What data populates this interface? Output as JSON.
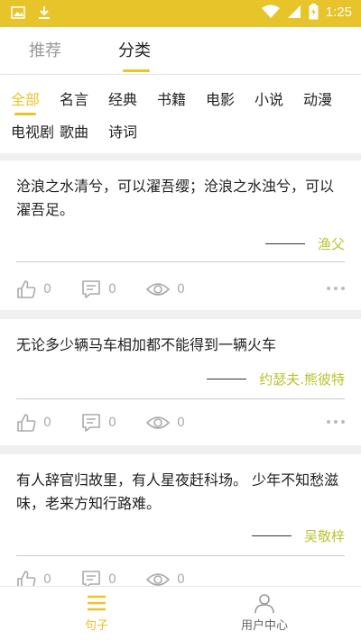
{
  "status": {
    "time": "1:25"
  },
  "top_tabs": [
    {
      "label": "推荐",
      "active": false
    },
    {
      "label": "分类",
      "active": true
    }
  ],
  "categories": [
    {
      "label": "全部",
      "active": true
    },
    {
      "label": "名言"
    },
    {
      "label": "经典"
    },
    {
      "label": "书籍"
    },
    {
      "label": "电影"
    },
    {
      "label": "小说"
    },
    {
      "label": "动漫"
    },
    {
      "label": "电视剧"
    },
    {
      "label": "歌曲"
    },
    {
      "label": "诗词"
    }
  ],
  "cards": [
    {
      "quote": "沧浪之水清兮，可以濯吾缨；沧浪之水浊兮，可以濯吾足。",
      "author": "渔父",
      "likes": "0",
      "comments": "0",
      "views": "0"
    },
    {
      "quote": "无论多少辆马车相加都不能得到一辆火车",
      "author": "约瑟夫.熊彼特",
      "likes": "0",
      "comments": "0",
      "views": "0"
    },
    {
      "quote": "有人辞官归故里，有人星夜赶科场。 少年不知愁滋味，老来方知行路难。",
      "author": "吴敬梓",
      "likes": "0",
      "comments": "0",
      "views": "0"
    }
  ],
  "bottom_nav": [
    {
      "label": "句子",
      "active": true
    },
    {
      "label": "用户中心",
      "active": false
    }
  ],
  "colors": {
    "accent": "#e8c529",
    "author": "#b8c430",
    "statusbar": "#e6c42a"
  }
}
